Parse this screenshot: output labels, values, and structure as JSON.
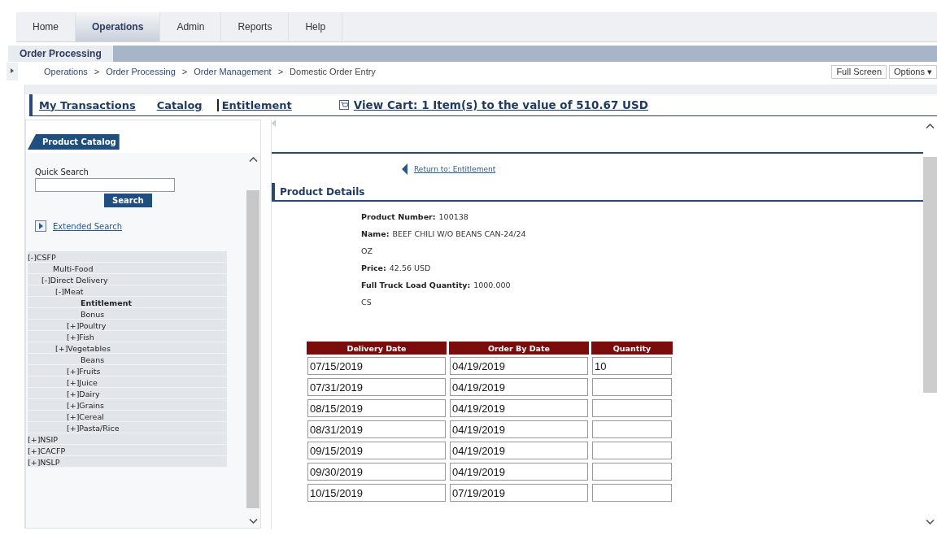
{
  "top_tabs": [
    {
      "label": "Home",
      "selected": false
    },
    {
      "label": "Operations",
      "selected": true
    },
    {
      "label": "Admin",
      "selected": false
    },
    {
      "label": "Reports",
      "selected": false
    },
    {
      "label": "Help",
      "selected": false
    }
  ],
  "sub_tabs": [
    {
      "label": "Order Processing",
      "selected": true
    }
  ],
  "breadcrumb": [
    "Operations",
    ">",
    "Order Processing",
    ">",
    "Order Management",
    ">",
    "Domestic Order Entry"
  ],
  "header_buttons": [
    "Full Screen",
    "Options ▾"
  ],
  "nav_links": [
    "My Transactions",
    "Catalog",
    "Entitlement"
  ],
  "cart_link": "View Cart: 1 Item(s) to the value of 510.67 USD",
  "sidebar": {
    "title": "Product Catalog",
    "quick_search_label": "Quick Search",
    "search_button": "Search",
    "extended_search": "Extended Search",
    "tree": [
      {
        "label": "[-]CSFP",
        "selected": false,
        "children": [
          {
            "label": "Multi-Food",
            "selected": false
          },
          {
            "label": "[-]Direct Delivery",
            "selected": false,
            "children": [
              {
                "label": "[-]Meat",
                "selected": false,
                "children": [
                  {
                    "label": "Entitlement",
                    "selected": true
                  },
                  {
                    "label": "Bonus",
                    "selected": false
                  }
                ]
              },
              {
                "label": "[+]Poultry",
                "selected": false
              },
              {
                "label": "[+]Fish",
                "selected": false
              },
              {
                "label": "[+]Vegetables",
                "selected": false,
                "children": [
                  {
                    "label": "Beans",
                    "selected": false
                  }
                ]
              },
              {
                "label": "[+]Fruits",
                "selected": false
              },
              {
                "label": "[+]Juice",
                "selected": false
              },
              {
                "label": "[+]Dairy",
                "selected": false
              },
              {
                "label": "[+]Grains",
                "selected": false
              },
              {
                "label": "[+]Cereal",
                "selected": false
              },
              {
                "label": "[+]Pasta/Rice",
                "selected": false
              }
            ]
          }
        ]
      },
      {
        "label": "[+]NSIP",
        "selected": false
      },
      {
        "label": "[+]CACFP",
        "selected": false
      },
      {
        "label": "[+]NSLP",
        "selected": false
      }
    ]
  },
  "return_link": "Return to: Entitlement",
  "section_title": "Product Details",
  "details": [
    {
      "label": "Product Number:",
      "value": "100138"
    },
    {
      "label": "Name:",
      "value": "BEEF CHILI W/O BEANS CAN-24/24"
    },
    {
      "value": "OZ"
    },
    {
      "label": "Price:",
      "value": "42.56 USD"
    },
    {
      "label": "Full Truck Load Quantity:",
      "value": "1000.000"
    },
    {
      "value": "CS"
    }
  ],
  "table": {
    "columns": [
      "Delivery Date",
      "Order By Date",
      "Quantity"
    ],
    "rows": [
      {
        "delivery_date": "07/15/2019",
        "order_by_date": "04/19/2019",
        "quantity": "10"
      },
      {
        "delivery_date": "07/31/2019",
        "order_by_date": "04/19/2019"
      },
      {
        "delivery_date": "08/15/2019",
        "order_by_date": "04/19/2019"
      },
      {
        "delivery_date": "08/31/2019",
        "order_by_date": "04/19/2019"
      },
      {
        "delivery_date": "09/15/2019",
        "order_by_date": "04/19/2019"
      },
      {
        "delivery_date": "09/30/2019",
        "order_by_date": "04/19/2019"
      },
      {
        "delivery_date": "10/15/2019",
        "order_by_date": "07/19/2019"
      }
    ]
  }
}
